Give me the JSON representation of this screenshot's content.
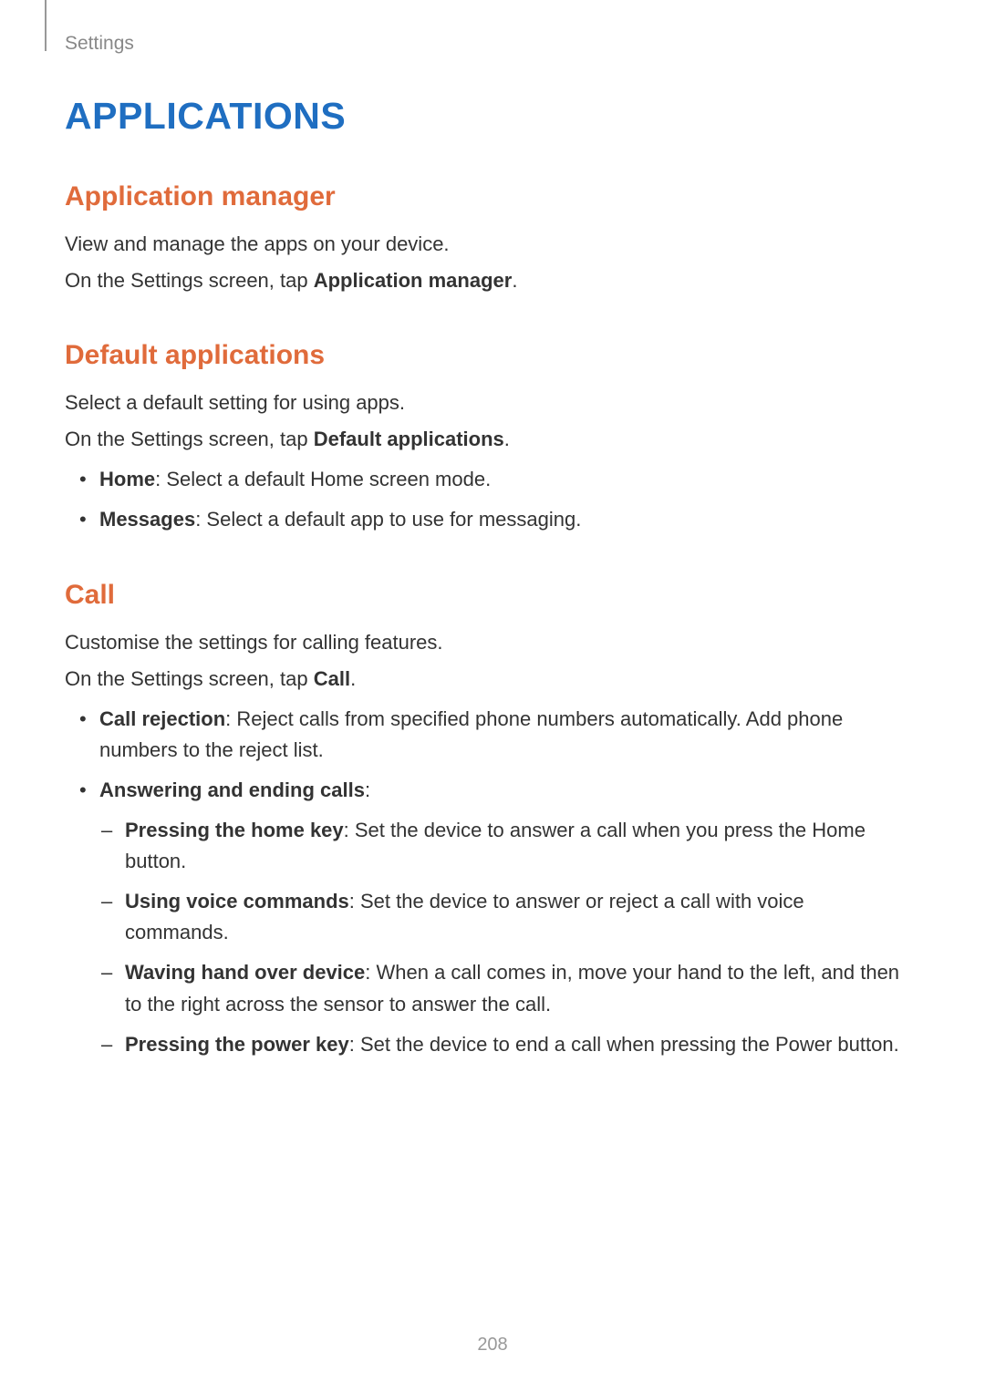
{
  "header": {
    "breadcrumb": "Settings"
  },
  "title": "APPLICATIONS",
  "sections": {
    "app_manager": {
      "heading": "Application manager",
      "p1": "View and manage the apps on your device.",
      "p2_prefix": "On the Settings screen, tap ",
      "p2_bold": "Application manager",
      "p2_suffix": "."
    },
    "default_apps": {
      "heading": "Default applications",
      "p1": "Select a default setting for using apps.",
      "p2_prefix": "On the Settings screen, tap ",
      "p2_bold": "Default applications",
      "p2_suffix": ".",
      "items": [
        {
          "bold": "Home",
          "text": ": Select a default Home screen mode."
        },
        {
          "bold": "Messages",
          "text": ": Select a default app to use for messaging."
        }
      ]
    },
    "call": {
      "heading": "Call",
      "p1": "Customise the settings for calling features.",
      "p2_prefix": "On the Settings screen, tap ",
      "p2_bold": "Call",
      "p2_suffix": ".",
      "items": [
        {
          "bold": "Call rejection",
          "text": ": Reject calls from specified phone numbers automatically. Add phone numbers to the reject list."
        },
        {
          "bold": "Answering and ending calls",
          "text": ":",
          "subitems": [
            {
              "bold": "Pressing the home key",
              "text": ": Set the device to answer a call when you press the Home button."
            },
            {
              "bold": "Using voice commands",
              "text": ": Set the device to answer or reject a call with voice commands."
            },
            {
              "bold": "Waving hand over device",
              "text": ": When a call comes in, move your hand to the left, and then to the right across the sensor to answer the call."
            },
            {
              "bold": "Pressing the power key",
              "text": ": Set the device to end a call when pressing the Power button."
            }
          ]
        }
      ]
    }
  },
  "page_number": "208"
}
